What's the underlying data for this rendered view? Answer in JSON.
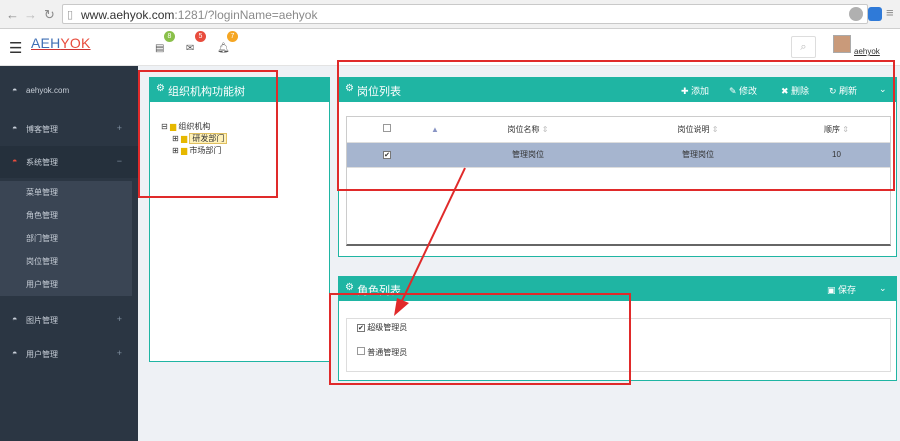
{
  "browser": {
    "url_host": "www.aehyok.com",
    "url_rest": ":1281/?loginName=aehyok"
  },
  "header": {
    "logo_a": "AEH",
    "logo_b": "YOK",
    "badges": [
      "8",
      "5",
      "7"
    ],
    "username": "aehyok"
  },
  "sidebar": {
    "items": [
      {
        "label": "aehyok.com"
      },
      {
        "label": "博客管理",
        "expander": "+"
      },
      {
        "label": "系统管理",
        "expander": "−"
      },
      {
        "label": "图片管理",
        "expander": "+"
      },
      {
        "label": "用户管理",
        "expander": "+"
      }
    ],
    "subitems": [
      {
        "label": "菜单管理"
      },
      {
        "label": "角色管理"
      },
      {
        "label": "部门管理"
      },
      {
        "label": "岗位管理"
      },
      {
        "label": "用户管理"
      }
    ]
  },
  "org_panel": {
    "title": "组织机构功能树",
    "tree": {
      "root": "组织机构",
      "children": [
        "研发部门",
        "市场部门"
      ]
    }
  },
  "post_panel": {
    "title": "岗位列表",
    "actions": {
      "add": "添加",
      "edit": "修改",
      "delete": "删除",
      "refresh": "刷新"
    },
    "columns": [
      "岗位名称",
      "岗位说明",
      "顺序"
    ],
    "rows": [
      {
        "name": "管理岗位",
        "desc": "管理岗位",
        "order": "10",
        "checked": true
      }
    ]
  },
  "role_panel": {
    "title": "角色列表",
    "save": "保存",
    "roles": [
      {
        "label": "超级管理员",
        "checked": true
      },
      {
        "label": "普通管理员",
        "checked": false
      }
    ]
  },
  "colors": {
    "accent": "#1fb5a3",
    "sidebar": "#2b3643",
    "selected_row": "#a6b5cf",
    "annotation": "#e02a2a"
  }
}
